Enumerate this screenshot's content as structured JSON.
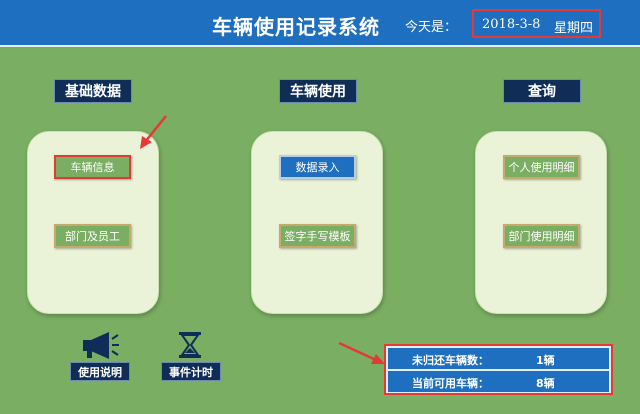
{
  "header": {
    "title": "车辆使用记录系统",
    "today_label": "今天是：",
    "date": "2018-3-8",
    "weekday": "星期四"
  },
  "sections": {
    "basic": {
      "title": "基础数据",
      "buttons": [
        "车辆信息",
        "部门及员工"
      ]
    },
    "usage": {
      "title": "车辆使用",
      "buttons": [
        "数据录入",
        "签字手写模板"
      ]
    },
    "query": {
      "title": "查询",
      "buttons": [
        "个人使用明细",
        "部门使用明细"
      ]
    }
  },
  "tools": {
    "help_label": "使用说明",
    "help_icon": "megaphone-icon",
    "timer_label": "事件计时",
    "timer_icon": "hourglass-icon"
  },
  "stats": {
    "unreturned_label": "未归还车辆数：",
    "unreturned_value": "1辆",
    "available_label": "当前可用车辆：",
    "available_value": "8辆"
  },
  "colors": {
    "background": "#7aae63",
    "header": "#1f6fc0",
    "heading_dark": "#0f2d56",
    "highlight": "#e53935"
  }
}
